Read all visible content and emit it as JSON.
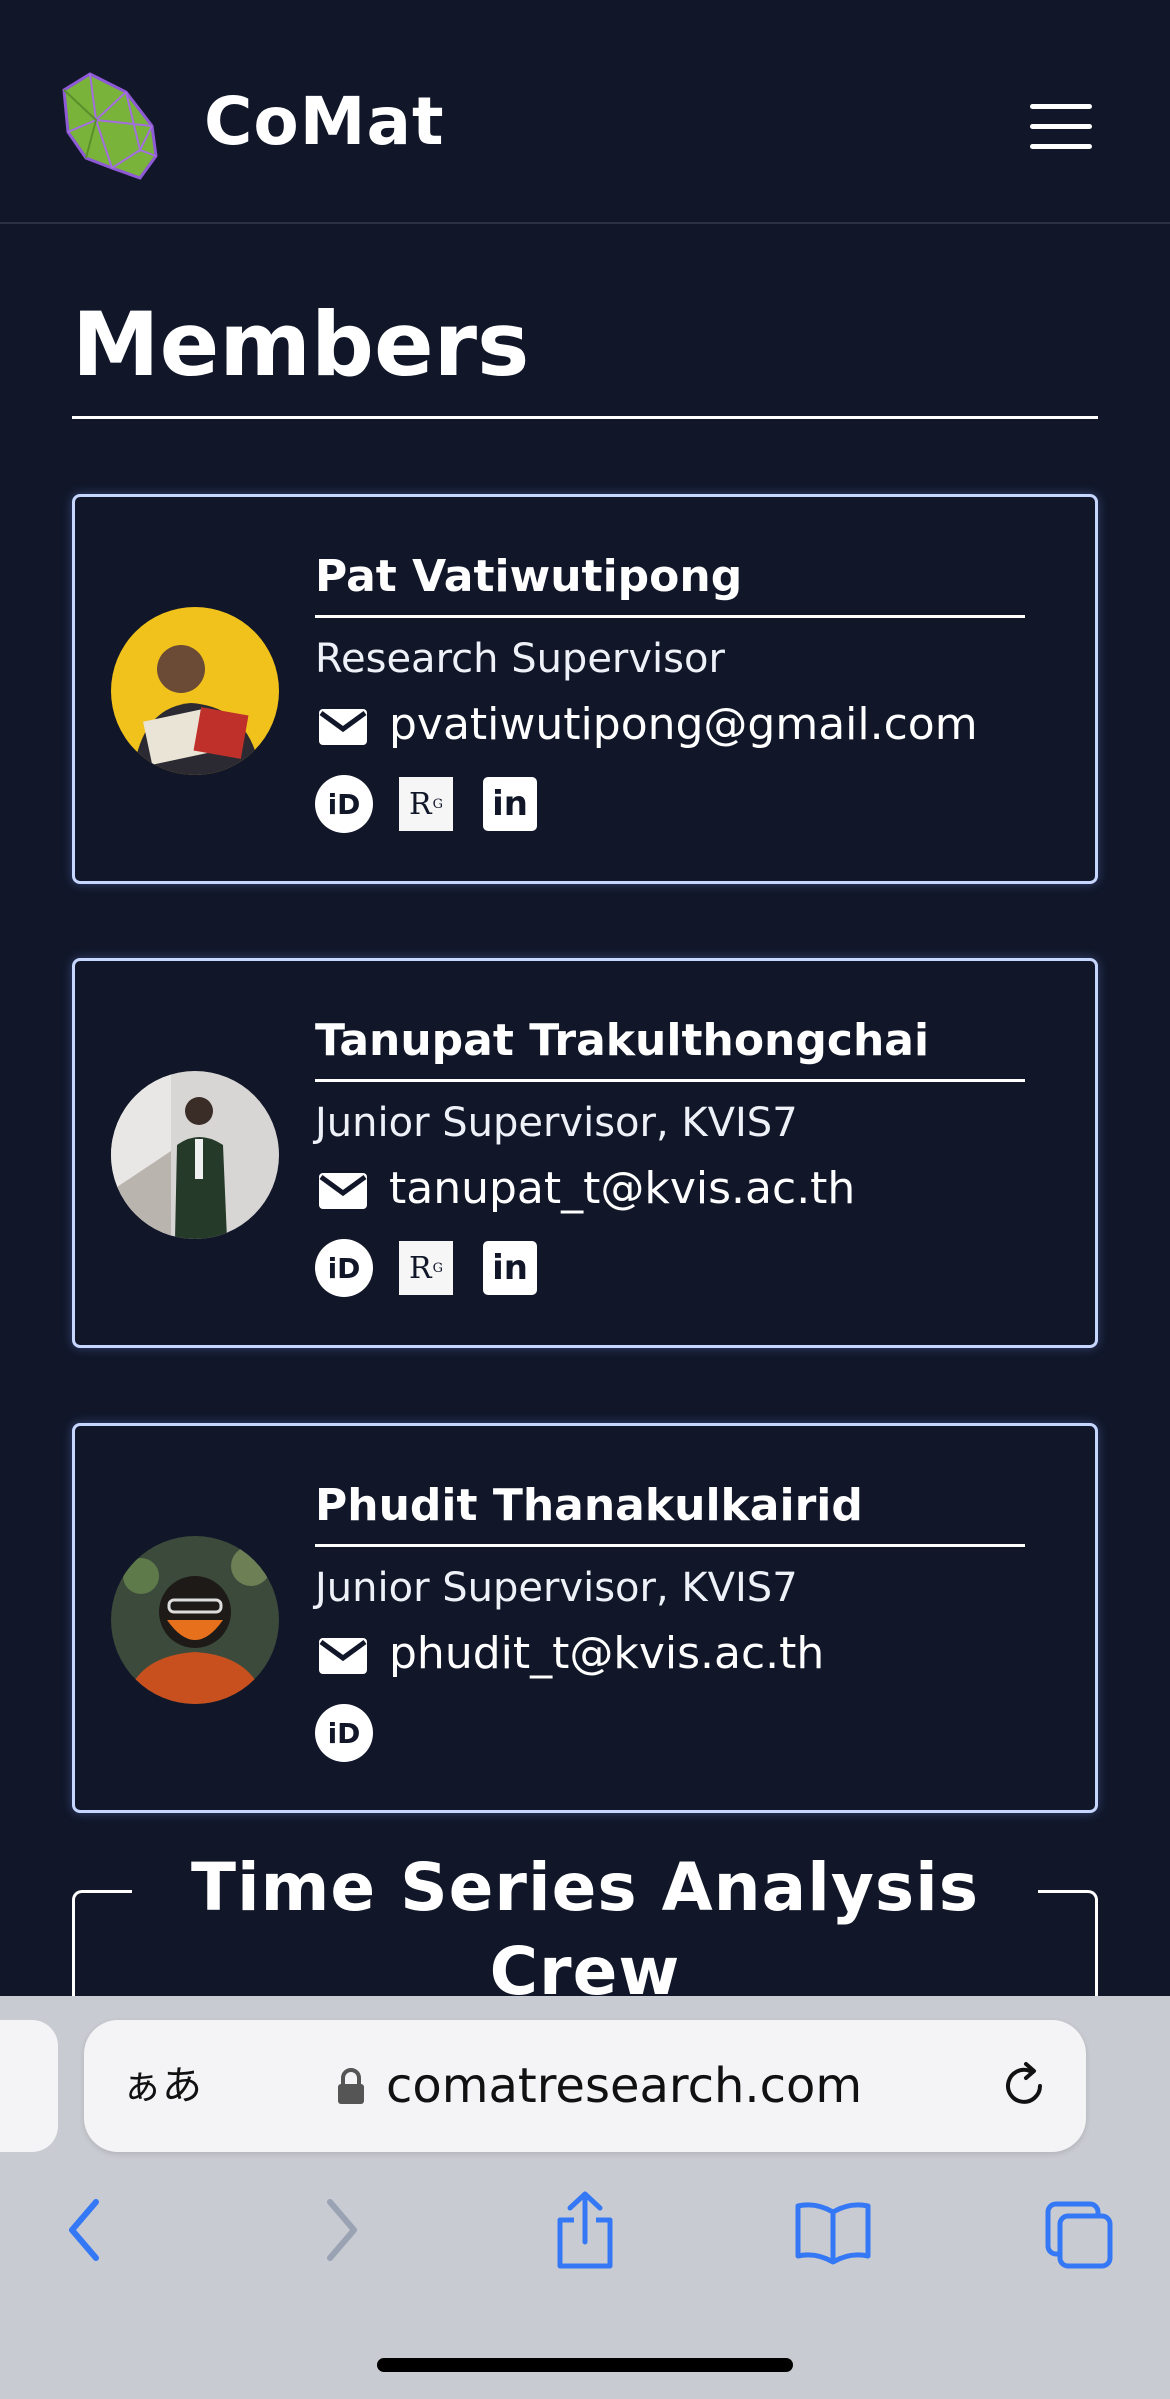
{
  "header": {
    "brand": "CoMat",
    "menu_icon": "hamburger-menu-icon"
  },
  "page": {
    "title": "Members"
  },
  "members": [
    {
      "name": "Pat Vatiwutipong",
      "role": "Research Supervisor",
      "email": "pvatiwutipong@gmail.com",
      "links": [
        "orcid-icon",
        "researchgate-icon",
        "linkedin-icon"
      ]
    },
    {
      "name": "Tanupat Trakulthongchai",
      "role": "Junior Supervisor, KVIS7",
      "email": "tanupat_t@kvis.ac.th",
      "links": [
        "orcid-icon",
        "researchgate-icon",
        "linkedin-icon"
      ]
    },
    {
      "name": "Phudit Thanakulkairid",
      "role": "Junior Supervisor, KVIS7",
      "email": "phudit_t@kvis.ac.th",
      "links": [
        "orcid-icon"
      ]
    }
  ],
  "link_glyphs": {
    "orcid": "iD",
    "researchgate": "R",
    "researchgate_sup": "G",
    "linkedin": "in"
  },
  "crew": {
    "title": "Time Series Analysis Crew"
  },
  "browser": {
    "text_size_label": "ぁあ",
    "url": "comatresearch.com",
    "accent_color": "#3478f6"
  },
  "colors": {
    "background": "#111729",
    "card_border": "#c6d6ff"
  }
}
